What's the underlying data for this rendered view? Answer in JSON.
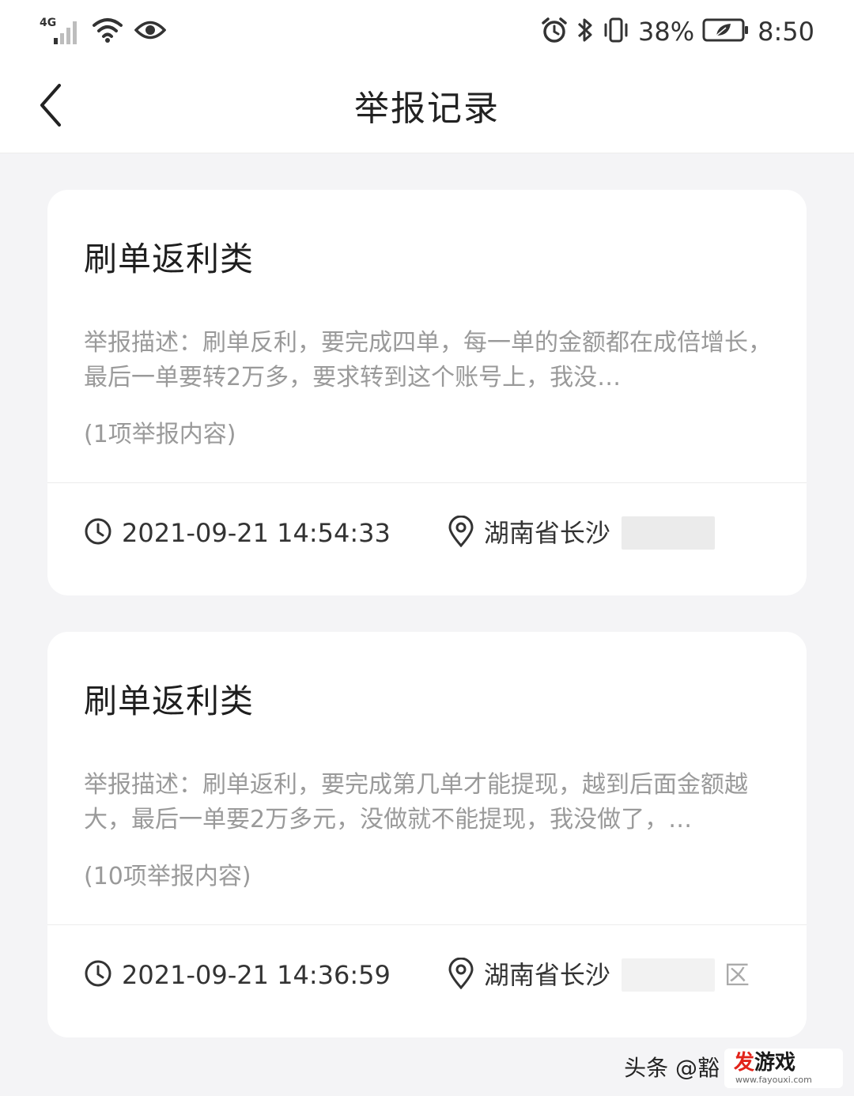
{
  "status_bar": {
    "network": "4G",
    "battery_percent": "38%",
    "time": "8:50",
    "icons": [
      "signal-icon",
      "wifi-icon",
      "eye-icon",
      "alarm-icon",
      "bluetooth-icon",
      "vibrate-icon",
      "battery-icon"
    ]
  },
  "header": {
    "title": "举报记录",
    "back_icon": "chevron-left-icon"
  },
  "reports": [
    {
      "category": "刷单返利类",
      "description": "举报描述：刷单反利，要完成四单，每一单的金额都在成倍增长，最后一单要转2万多，要求转到这个账号上，我没…",
      "item_count": "(1项举报内容)",
      "time": "2021-09-21 14:54:33",
      "location": "湖南省长沙"
    },
    {
      "category": "刷单返利类",
      "description": "举报描述：刷单返利，要完成第几单才能提现，越到后面金额越大，最后一单要2万多元，没做就不能提现，我没做了，…",
      "item_count": "(10项举报内容)",
      "time": "2021-09-21 14:36:59",
      "location": "湖南省长沙",
      "location_suffix": "区"
    }
  ],
  "watermark": {
    "text": "头条 @豁",
    "badge_main_red": "发",
    "badge_main_dark": "游戏",
    "badge_url": "www.fayouxi.com"
  },
  "colors": {
    "background": "#f4f4f6",
    "card": "#ffffff",
    "title_text": "#222222",
    "secondary_text": "#9a9a9a",
    "badge_red": "#e2231a"
  }
}
